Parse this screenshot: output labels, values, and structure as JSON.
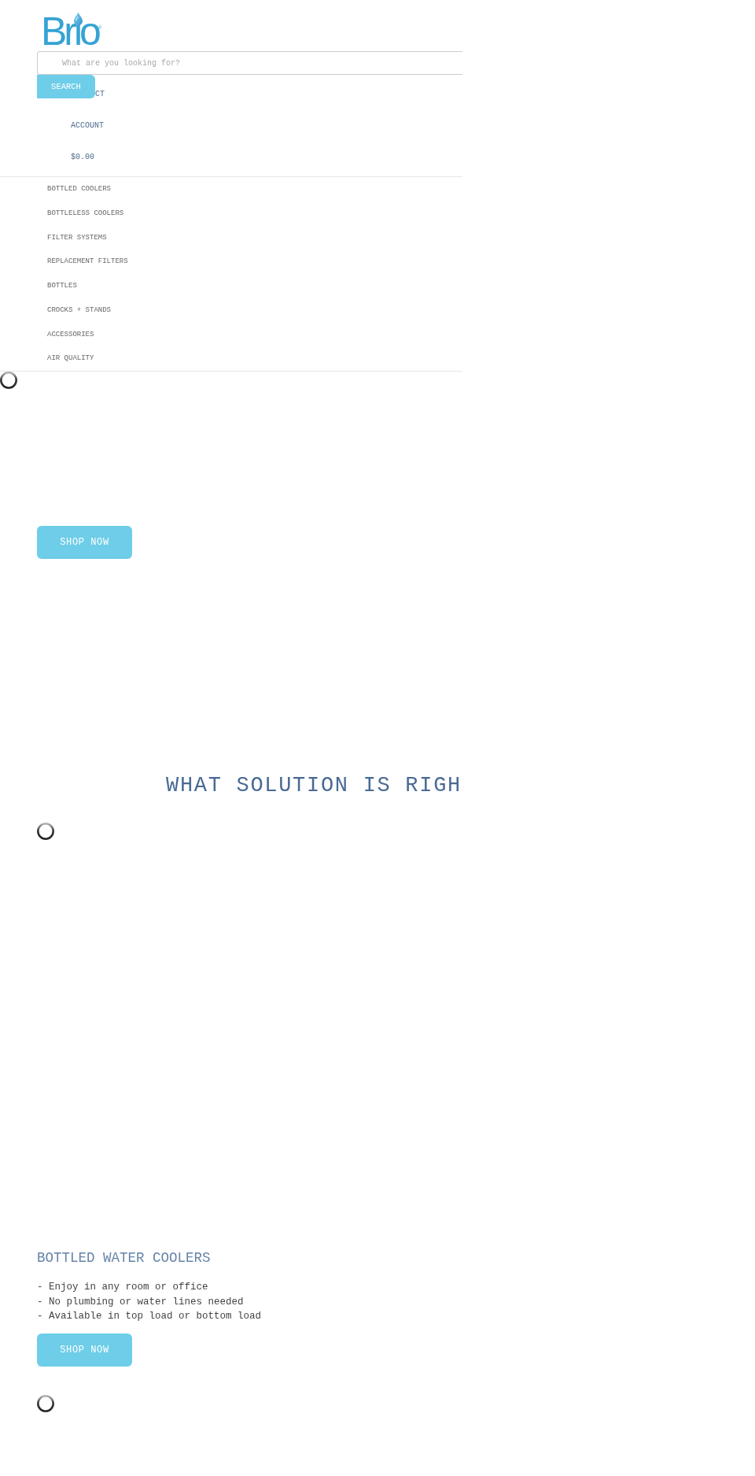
{
  "header": {
    "logo": {
      "text": "Brio$^{®}$"
    },
    "search": {
      "placeholder": "What are you looking for?",
      "button": "SEARCH"
    },
    "links": [
      "CT",
      "ACCOUNT",
      "$0.00"
    ]
  },
  "nav": {
    "items": [
      "BOTTLED COOLERS",
      "BOTTLELESS COOLERS",
      "FILTER SYSTEMS",
      "REPLACEMENT FILTERS",
      "BOTTLES",
      "CROCKS + STANDS",
      "ACCESSORIES",
      "AIR QUALITY"
    ]
  },
  "hero": {
    "button": "SHOP NOW"
  },
  "solutions": {
    "title": "WHAT SOLUTION IS RIGH"
  },
  "products": [
    {
      "title": "BOTTLED WATER COOLERS",
      "features": [
        "- Enjoy in any room or office",
        "- No plumbing or water lines needed",
        "- Available in top load or bottom load"
      ],
      "button": "SHOP NOW"
    }
  ]
}
